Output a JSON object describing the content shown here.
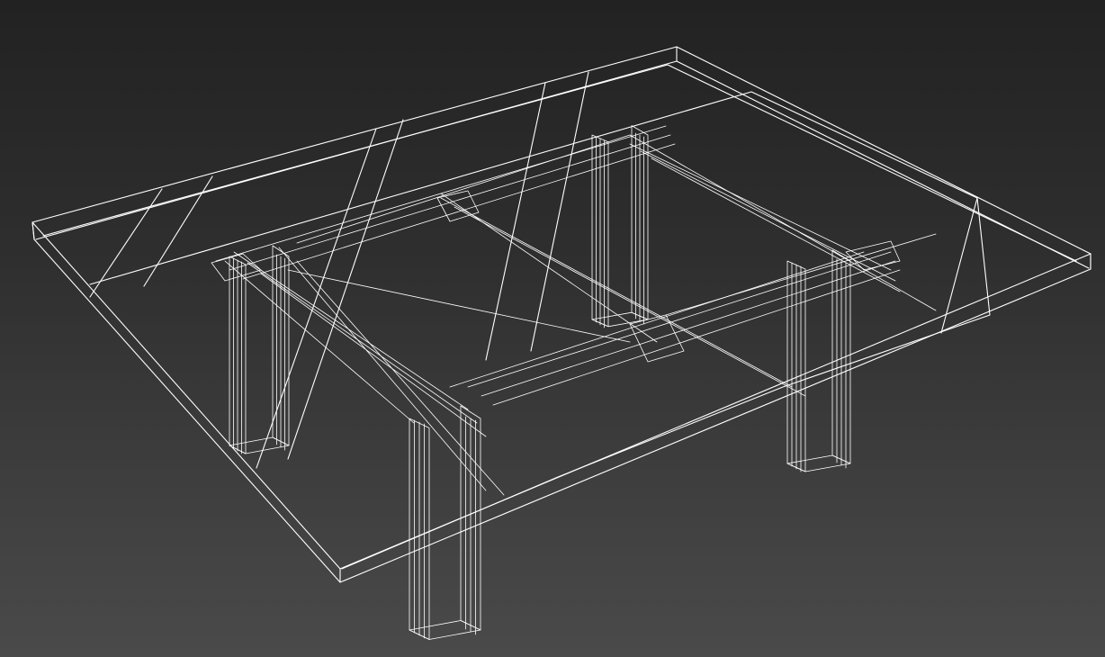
{
  "viewport": {
    "render_mode": "wireframe",
    "background_top_color": "#222222",
    "background_bottom_color": "#4a4a4a",
    "wire_color": "#ffffff"
  },
  "model": {
    "object": "table",
    "parts": [
      "tabletop",
      "frame-rail",
      "leg-front-left",
      "leg-front-right",
      "leg-back-left",
      "leg-back-right"
    ]
  }
}
